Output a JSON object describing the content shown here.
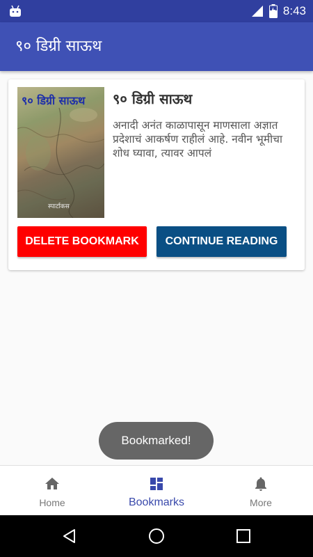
{
  "status_bar": {
    "time": "8:43"
  },
  "app_bar": {
    "title": "९० डिग्री साऊथ"
  },
  "bookmark_card": {
    "cover_title": "९० डिग्री साऊथ",
    "cover_author": "स्पार्टाकस",
    "title": "९० डिग्री साऊथ",
    "description": "अनादी अनंत काळापासून माणसाला अज्ञात प्रदेशाचं आकर्षण राहीलं आहे. नवीन भूमीचा शोध घ्यावा, त्यावर आपलं",
    "delete_label": "DELETE BOOKMARK",
    "continue_label": "CONTINUE READING"
  },
  "toast": {
    "message": "Bookmarked!"
  },
  "bottom_nav": {
    "items": [
      {
        "label": "Home",
        "icon": "home-icon"
      },
      {
        "label": "Bookmarks",
        "icon": "bookmarks-icon"
      },
      {
        "label": "More",
        "icon": "bell-icon"
      }
    ],
    "active_index": 1
  },
  "colors": {
    "status_bar": "#303f9f",
    "app_bar": "#3f51b5",
    "delete_button": "#ff0000",
    "continue_button": "#0a4f84",
    "active_nav": "#3949ab"
  }
}
